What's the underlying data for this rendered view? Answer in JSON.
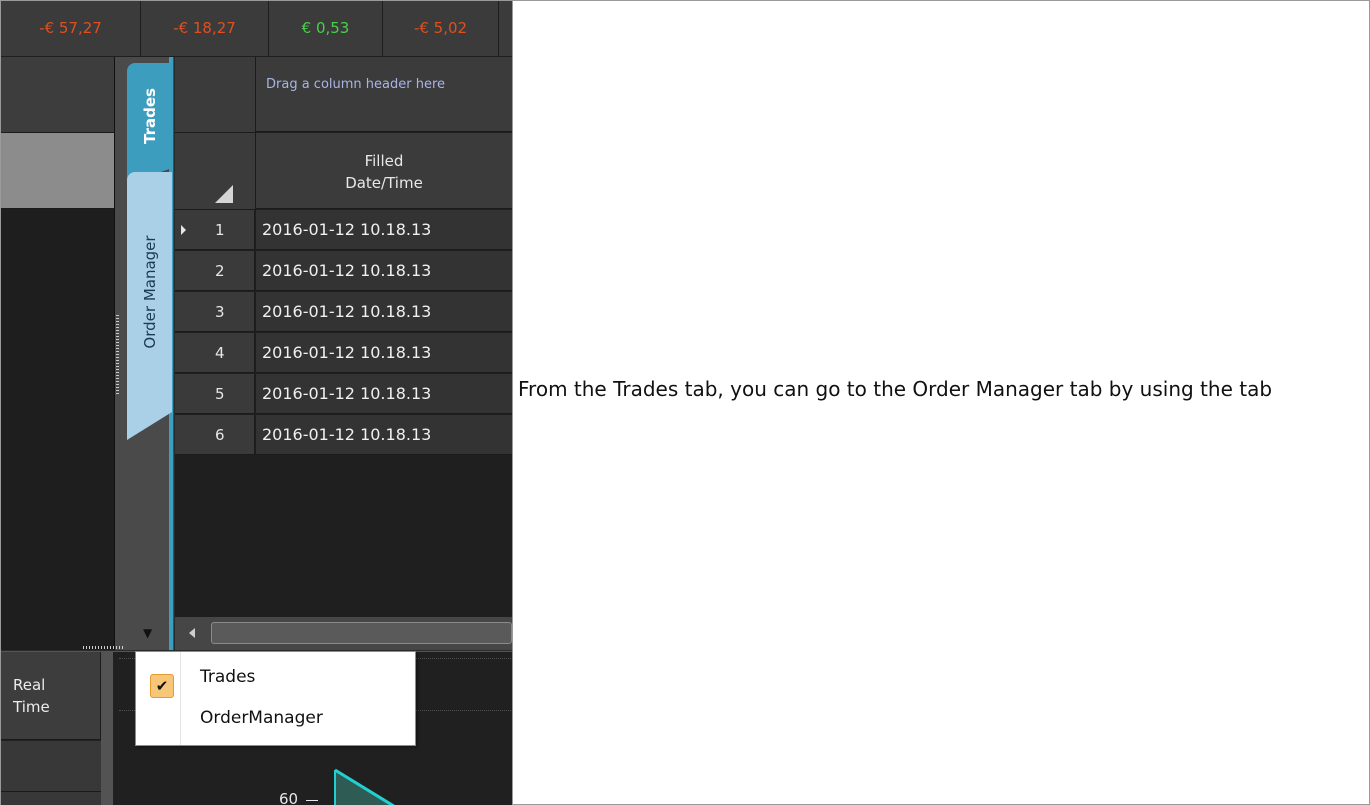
{
  "pnl_values": [
    {
      "text": "-€ 57,27",
      "color": "#e0501e"
    },
    {
      "text": "-€ 18,27",
      "color": "#e0501e"
    },
    {
      "text": "€ 0,53",
      "color": "#48d148"
    },
    {
      "text": "-€ 5,02",
      "color": "#e0501e"
    }
  ],
  "tabs": {
    "trades": "Trades",
    "order_manager": "Order Manager",
    "dropdown_icon": "triangle-down-icon"
  },
  "grid": {
    "group_panel_hint": "Drag a column header here",
    "column_header": [
      "Filled",
      "Date/Time"
    ],
    "rows": [
      {
        "num": "1",
        "value": "2016-01-12 10.18.13"
      },
      {
        "num": "2",
        "value": "2016-01-12 10.18.13"
      },
      {
        "num": "3",
        "value": "2016-01-12 10.18.13"
      },
      {
        "num": "4",
        "value": "2016-01-12 10.18.13"
      },
      {
        "num": "5",
        "value": "2016-01-12 10.18.13"
      },
      {
        "num": "6",
        "value": "2016-01-12 10.18.13"
      }
    ]
  },
  "bottom": {
    "header": [
      "Real",
      "Time"
    ],
    "axis_tick": "60"
  },
  "menu": {
    "items": [
      {
        "label": "Trades",
        "checked": true
      },
      {
        "label": "OrderManager",
        "checked": false
      }
    ]
  },
  "description": "From the Trades tab, you can go to the Order Manager tab by using the tab",
  "colors": {
    "tab_active": "#3d9dbf",
    "tab_inactive": "#a9d0e6",
    "check_bg": "#f7c678"
  }
}
